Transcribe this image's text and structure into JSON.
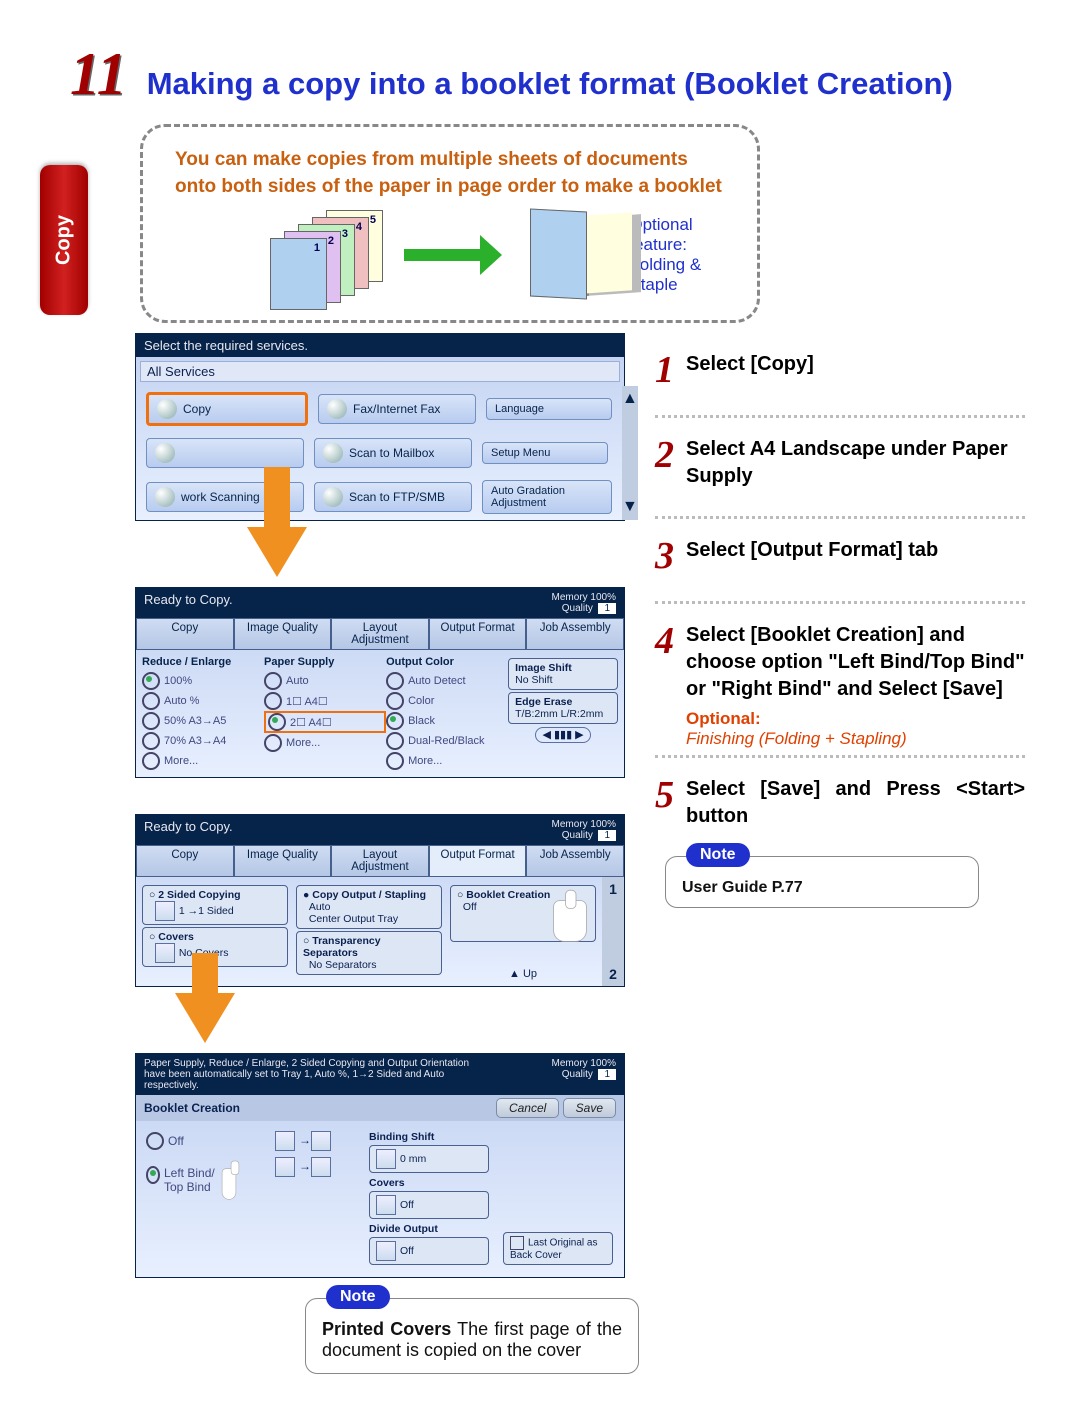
{
  "chapter_number": "11",
  "title": "Making a copy into a booklet format (Booklet Creation)",
  "side_tab": "Copy",
  "intro_text": "You can make copies from multiple sheets of documents onto both sides of the paper in page order to make a booklet",
  "stack_labels": [
    "1",
    "2",
    "3",
    "4",
    "5"
  ],
  "optional_feature_lines": [
    "Optional feature:",
    "Folding & Staple"
  ],
  "panel1": {
    "header": "Select the required services.",
    "all_services": "All Services",
    "services": [
      "Copy",
      "Fax/Internet Fax",
      "Language",
      "",
      "Scan to Mailbox",
      "Setup Menu",
      "work Scanning",
      "Scan to FTP/SMB",
      "Auto Gradation Adjustment"
    ]
  },
  "panel2": {
    "status": "Ready to Copy.",
    "memory": "Memory 100%",
    "quality": "Quality",
    "quality_val": "1",
    "tabs": [
      "Copy",
      "Image Quality",
      "Layout Adjustment",
      "Output Format",
      "Job Assembly"
    ],
    "col_reduce": {
      "title": "Reduce / Enlarge",
      "items": [
        "100%",
        "Auto %",
        "50%  A3→A5",
        "70%  A3→A4",
        "More..."
      ]
    },
    "col_paper": {
      "title": "Paper Supply",
      "items": [
        "Auto",
        "1☐  A4☐",
        "2☐  A4☐",
        "More..."
      ]
    },
    "col_output": {
      "title": "Output Color",
      "items": [
        "Auto Detect",
        "Color",
        "Black",
        "Dual-Red/Black",
        "More..."
      ]
    },
    "side": [
      {
        "t": "Image Shift",
        "v": "No Shift"
      },
      {
        "t": "Edge Erase",
        "v": "T/B:2mm   L/R:2mm"
      }
    ]
  },
  "panel3": {
    "status": "Ready to Copy.",
    "memory": "Memory 100%",
    "quality": "Quality",
    "quality_val": "1",
    "tabs": [
      "Copy",
      "Image Quality",
      "Layout Adjustment",
      "Output Format",
      "Job Assembly"
    ],
    "items": {
      "two_sided": {
        "t": "2 Sided Copying",
        "v": "1 →1 Sided"
      },
      "copy_out": {
        "t": "Copy Output / Stapling",
        "v1": "Auto",
        "v2": "Center Output Tray"
      },
      "booklet": {
        "t": "Booklet Creation",
        "v": "Off"
      },
      "covers": {
        "t": "Covers",
        "v": "No Covers"
      },
      "transp": {
        "t": "Transparency Separators",
        "v": "No Separators"
      },
      "up_label": "Up",
      "page1": "1",
      "page2": "2"
    }
  },
  "panel4": {
    "header_text": "Paper Supply, Reduce / Enlarge, 2 Sided Copying and Output Orientation have been automatically set to Tray 1, Auto %, 1→2 Sided and Auto respectively.",
    "memory": "Memory 100%",
    "quality": "Quality",
    "quality_val": "1",
    "section": "Booklet Creation",
    "cancel": "Cancel",
    "save": "Save",
    "off": "Off",
    "left_bind": "Left Bind/ Top Bind",
    "binding_shift": {
      "t": "Binding Shift",
      "v": "0 mm"
    },
    "covers": {
      "t": "Covers",
      "v": "Off"
    },
    "divide": {
      "t": "Divide Output",
      "v": "Off"
    },
    "last": "Last Original as Back Cover"
  },
  "steps": [
    {
      "n": "1",
      "t": "Select [Copy]"
    },
    {
      "n": "2",
      "t": "Select A4 Landscape under Paper Supply"
    },
    {
      "n": "3",
      "t": "Select [Output Format] tab"
    },
    {
      "n": "4",
      "t": "Select [Booklet Creation] and choose option \"Left Bind/Top Bind\" or \"Right Bind\" and Select [Save]"
    },
    {
      "n": "5",
      "t": "Select [Save] and Press <Start> button"
    }
  ],
  "step4_opt_label": "Optional:",
  "step4_opt_text": "Finishing (Folding + Stapling)",
  "note1": {
    "badge": "Note",
    "bold": "Printed Covers",
    "rest": " The first page of the document is copied on the cover"
  },
  "note2": {
    "badge": "Note",
    "text": "User Guide P.77"
  }
}
